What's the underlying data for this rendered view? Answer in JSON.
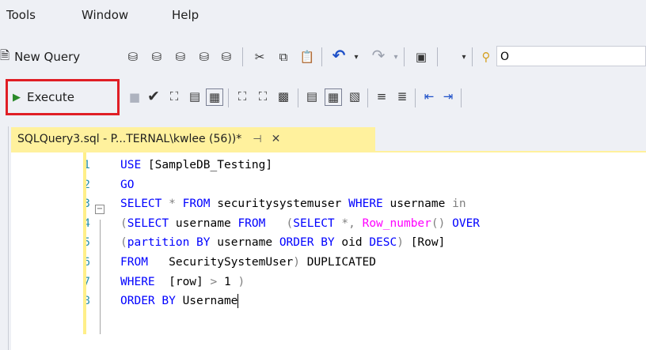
{
  "menu": {
    "tools": "Tools",
    "window": "Window",
    "help": "Help"
  },
  "toolbar1": {
    "new_query": "New Query"
  },
  "toolbar2": {
    "execute": "Execute",
    "partial_label": "O"
  },
  "tab": {
    "title": "SQLQuery3.sql - P...TERNAL\\kwlee (56))*",
    "pin": "⊣",
    "close": "✕"
  },
  "editor": {
    "lines": [
      {
        "n": "1",
        "parts": [
          [
            "kw",
            "USE "
          ],
          [
            "",
            "[SampleDB_Testing]"
          ]
        ]
      },
      {
        "n": "2",
        "parts": [
          [
            "kw",
            "GO"
          ]
        ]
      },
      {
        "n": "3",
        "parts": [
          [
            "kw",
            "SELECT"
          ],
          [
            "gr",
            " * "
          ],
          [
            "kw",
            "FROM"
          ],
          [
            "",
            " securitysystemuser "
          ],
          [
            "kw",
            "WHERE"
          ],
          [
            "",
            " username "
          ],
          [
            "gr",
            "in"
          ]
        ]
      },
      {
        "n": "4",
        "parts": [
          [
            "gr",
            "("
          ],
          [
            "kw",
            "SELECT"
          ],
          [
            "",
            " username "
          ],
          [
            "kw",
            "FROM"
          ],
          [
            "gr",
            "   ("
          ],
          [
            "kw",
            "SELECT"
          ],
          [
            "gr",
            " *, "
          ],
          [
            "fn",
            "Row_number"
          ],
          [
            "gr",
            "() "
          ],
          [
            "kw",
            "OVER"
          ]
        ]
      },
      {
        "n": "5",
        "parts": [
          [
            "gr",
            "("
          ],
          [
            "kw",
            "partition BY"
          ],
          [
            "",
            " username "
          ],
          [
            "kw",
            "ORDER BY"
          ],
          [
            "",
            " oid "
          ],
          [
            "kw",
            "DESC"
          ],
          [
            "gr",
            ") "
          ],
          [
            "",
            "[Row]"
          ]
        ]
      },
      {
        "n": "6",
        "parts": [
          [
            "kw",
            "FROM"
          ],
          [
            "",
            "   SecuritySystemUser"
          ],
          [
            "gr",
            ")"
          ],
          [
            "",
            " DUPLICATED"
          ]
        ]
      },
      {
        "n": "7",
        "parts": [
          [
            "kw",
            "WHERE"
          ],
          [
            "",
            "  [row] "
          ],
          [
            "gr",
            ">"
          ],
          [
            "",
            " 1 "
          ],
          [
            "gr",
            ")"
          ]
        ]
      },
      {
        "n": "8",
        "parts": [
          [
            "kw",
            "ORDER BY"
          ],
          [
            "",
            " Username"
          ]
        ]
      }
    ]
  },
  "colors": {
    "highlight": "#e01e25",
    "tab_bg": "#fff19d",
    "keyword": "#0000ff",
    "function": "#ff00ff"
  }
}
